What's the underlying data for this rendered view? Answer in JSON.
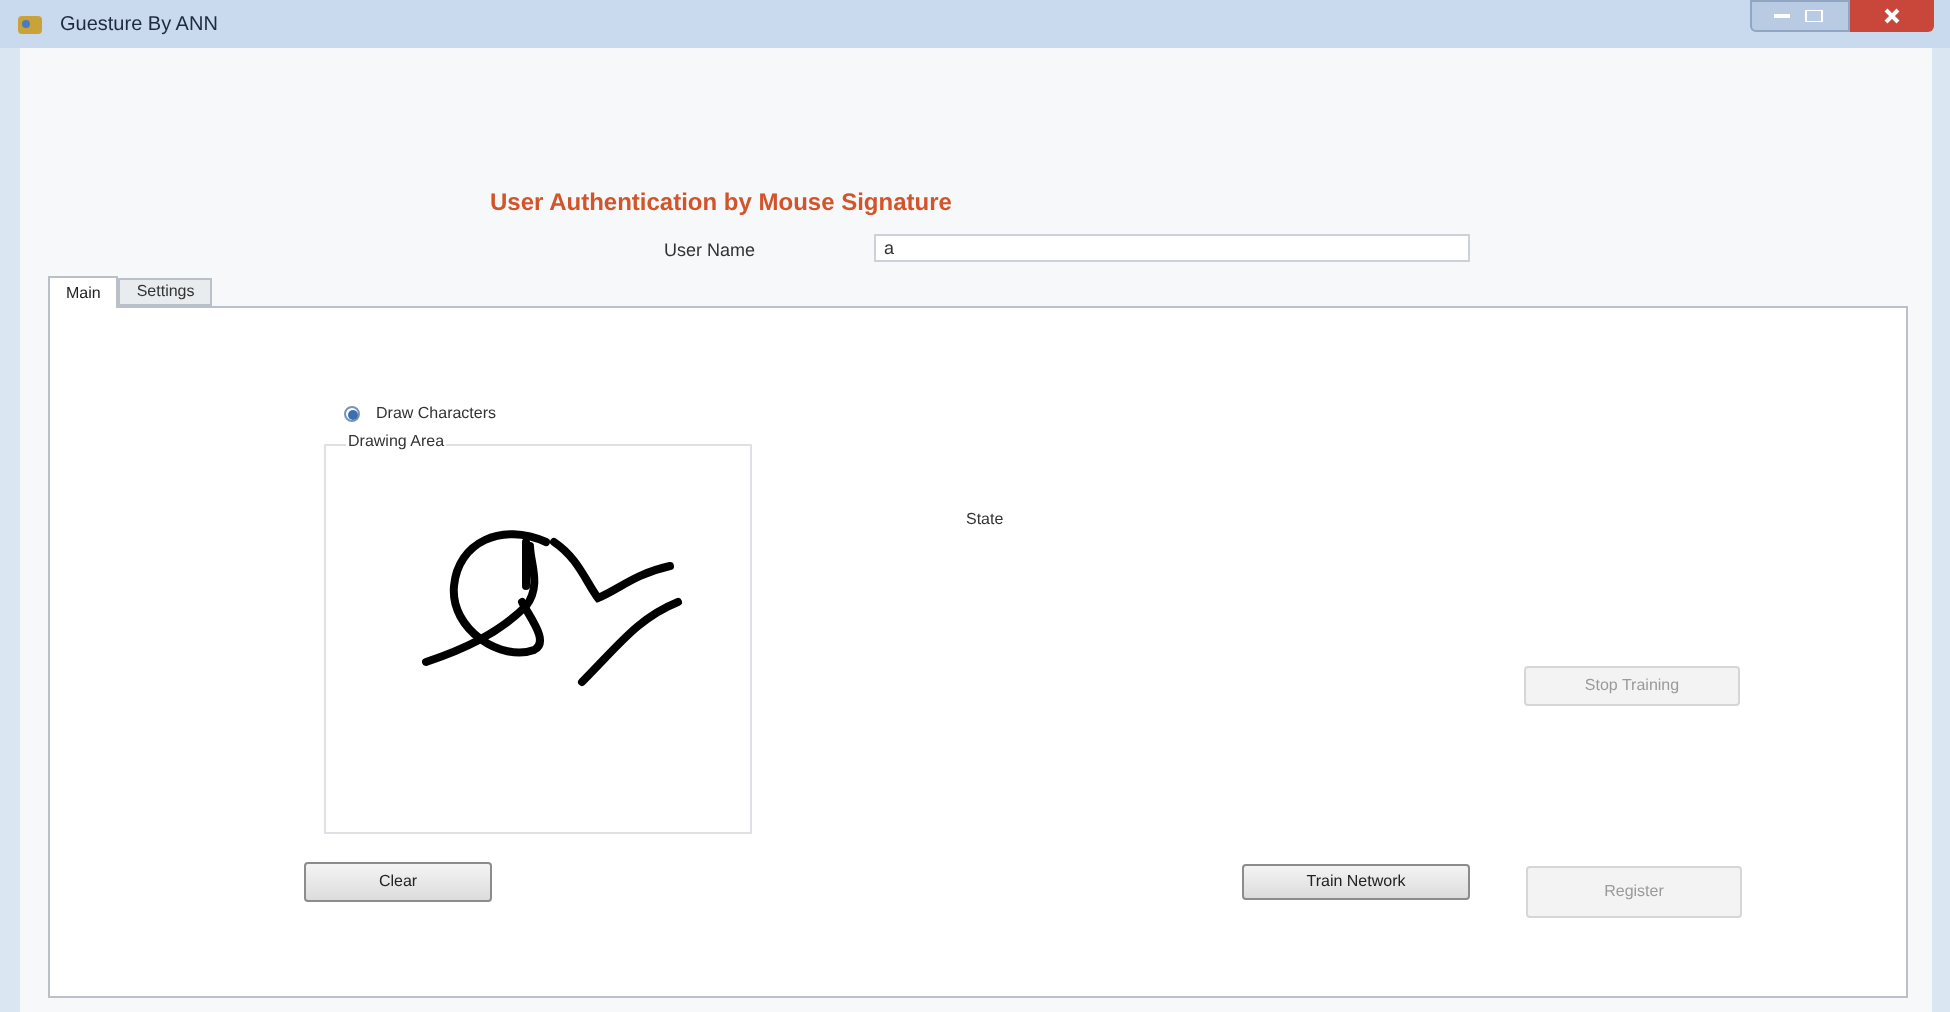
{
  "window": {
    "title": "Guesture By ANN"
  },
  "heading": "User Authentication by Mouse Signature",
  "user_name": {
    "label": "User Name",
    "value": "a"
  },
  "tabs": [
    {
      "label": "Main",
      "selected": true
    },
    {
      "label": "Settings",
      "selected": false
    }
  ],
  "mode_radio": {
    "label": "Draw Characters",
    "checked": true
  },
  "drawing_area": {
    "title": "Drawing Area"
  },
  "state_label": "State",
  "buttons": [
    {
      "kind": "stop",
      "label": "Stop Training",
      "disabled": true
    },
    {
      "kind": "clear",
      "label": "Clear",
      "disabled": false
    },
    {
      "kind": "train",
      "label": "Train Network",
      "disabled": false
    },
    {
      "kind": "register",
      "label": "Register",
      "disabled": true
    }
  ]
}
